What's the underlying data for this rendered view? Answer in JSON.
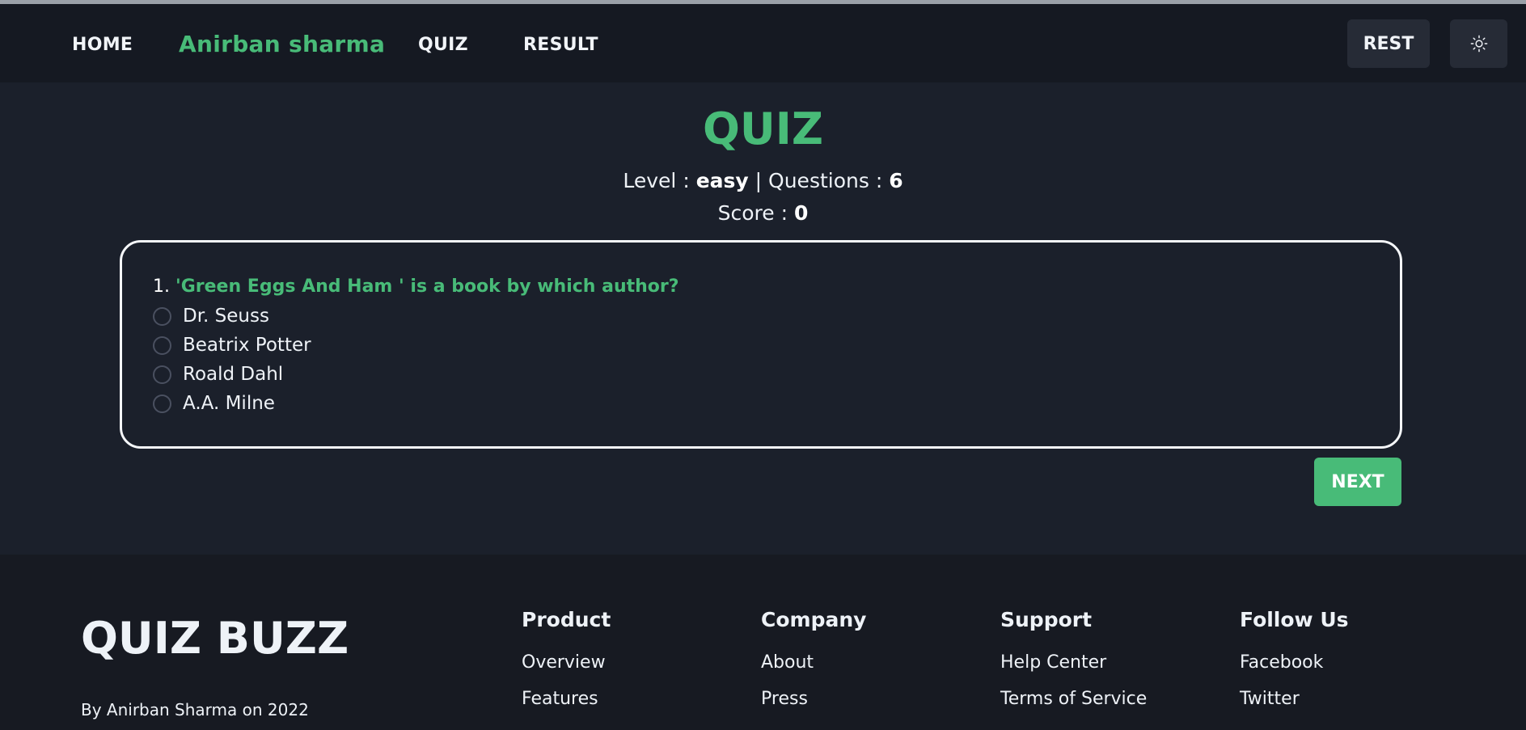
{
  "nav": {
    "home": "HOME",
    "brand": "Anirban sharma",
    "quiz": "QUIZ",
    "result": "RESULT",
    "rest": "REST",
    "theme_icon": "sun-icon"
  },
  "quiz": {
    "title": "QUIZ",
    "level_label": "Level : ",
    "level": "easy",
    "questions_label": " | Questions : ",
    "questions": "6",
    "score_label": "Score : ",
    "score": "0",
    "question_number": "1. ",
    "question": "'Green Eggs And Ham ' is a book by which author?",
    "options": [
      "Dr. Seuss",
      "Beatrix Potter",
      "Roald Dahl",
      "A.A. Milne"
    ],
    "next": "NEXT"
  },
  "footer": {
    "brand": "QUIZ BUZZ",
    "credit": "By Anirban Sharma on 2022",
    "columns": [
      {
        "title": "Product",
        "links": [
          "Overview",
          "Features"
        ]
      },
      {
        "title": "Company",
        "links": [
          "About",
          "Press"
        ]
      },
      {
        "title": "Support",
        "links": [
          "Help Center",
          "Terms of Service"
        ]
      },
      {
        "title": "Follow Us",
        "links": [
          "Facebook",
          "Twitter"
        ]
      }
    ]
  },
  "colors": {
    "accent": "#48bb78",
    "background": "#1b202b",
    "navbar": "#151922",
    "footer": "#171a22"
  }
}
